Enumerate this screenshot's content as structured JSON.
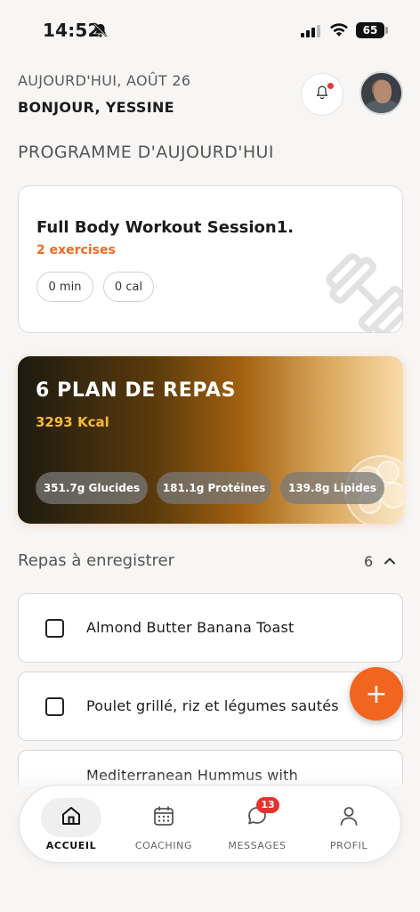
{
  "status_bar": {
    "time": "14:52",
    "battery": "65"
  },
  "header": {
    "date": "AUJOURD'HUI, AOÛT 26",
    "greeting": "BONJOUR, YESSINE"
  },
  "today_program": {
    "title": "PROGRAMME D'AUJOURD'HUI",
    "workout": {
      "title": "Full Body Workout Session1.",
      "subtitle": "2 exercises",
      "duration": "0 min",
      "calories": "0 cal"
    }
  },
  "meal_plan": {
    "title": "6 PLAN DE REPAS",
    "kcal": "3293 Kcal",
    "macros": {
      "carbs": "351.7g Glucides",
      "protein": "181.1g Protéines",
      "fat": "139.8g Lipides"
    }
  },
  "meals_section": {
    "title": "Repas à enregistrer",
    "count": "6",
    "items": [
      {
        "label": "Almond Butter Banana Toast"
      },
      {
        "label": "Poulet grillé, riz et légumes sautés"
      },
      {
        "label": "Mediterranean Hummus with"
      }
    ]
  },
  "fab": {
    "label": "+"
  },
  "bottom_nav": {
    "items": [
      {
        "label": "ACCUEIL",
        "icon": "home-icon",
        "active": true
      },
      {
        "label": "COACHING",
        "icon": "calendar-icon"
      },
      {
        "label": "MESSAGES",
        "icon": "chat-icon",
        "badge": "13"
      },
      {
        "label": "PROFIL",
        "icon": "person-icon"
      }
    ]
  },
  "colors": {
    "accent": "#f2651e",
    "orange_text": "#ef6a1f",
    "kcal_yellow": "#f6b93b",
    "badge_red": "#e5322d"
  }
}
